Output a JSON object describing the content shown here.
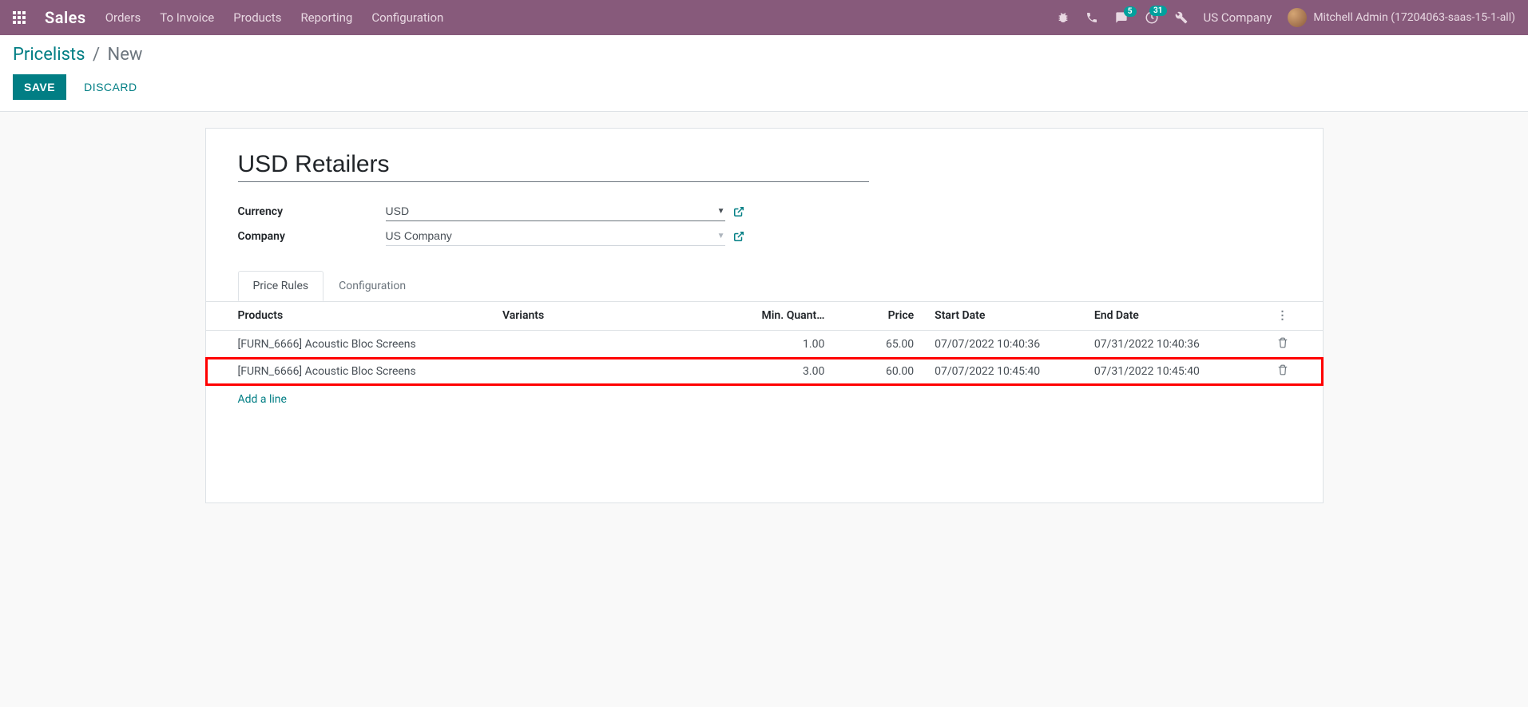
{
  "navbar": {
    "brand": "Sales",
    "menu": [
      "Orders",
      "To Invoice",
      "Products",
      "Reporting",
      "Configuration"
    ],
    "messages_badge": "5",
    "activities_badge": "31",
    "company": "US Company",
    "user": "Mitchell Admin (17204063-saas-15-1-all)"
  },
  "breadcrumb": {
    "parent": "Pricelists",
    "current": "New"
  },
  "actions": {
    "save": "SAVE",
    "discard": "DISCARD"
  },
  "form": {
    "title": "USD Retailers",
    "currency_label": "Currency",
    "currency_value": "USD",
    "company_label": "Company",
    "company_value": "US Company"
  },
  "tabs": {
    "price_rules": "Price Rules",
    "configuration": "Configuration"
  },
  "table": {
    "headers": {
      "products": "Products",
      "variants": "Variants",
      "min_qty": "Min. Quant…",
      "price": "Price",
      "start_date": "Start Date",
      "end_date": "End Date"
    },
    "rows": [
      {
        "product": "[FURN_6666] Acoustic Bloc Screens",
        "variants": "",
        "min_qty": "1.00",
        "price": "65.00",
        "start": "07/07/2022 10:40:36",
        "end": "07/31/2022 10:40:36"
      },
      {
        "product": "[FURN_6666] Acoustic Bloc Screens",
        "variants": "",
        "min_qty": "3.00",
        "price": "60.00",
        "start": "07/07/2022 10:45:40",
        "end": "07/31/2022 10:45:40"
      }
    ],
    "add_line": "Add a line"
  }
}
